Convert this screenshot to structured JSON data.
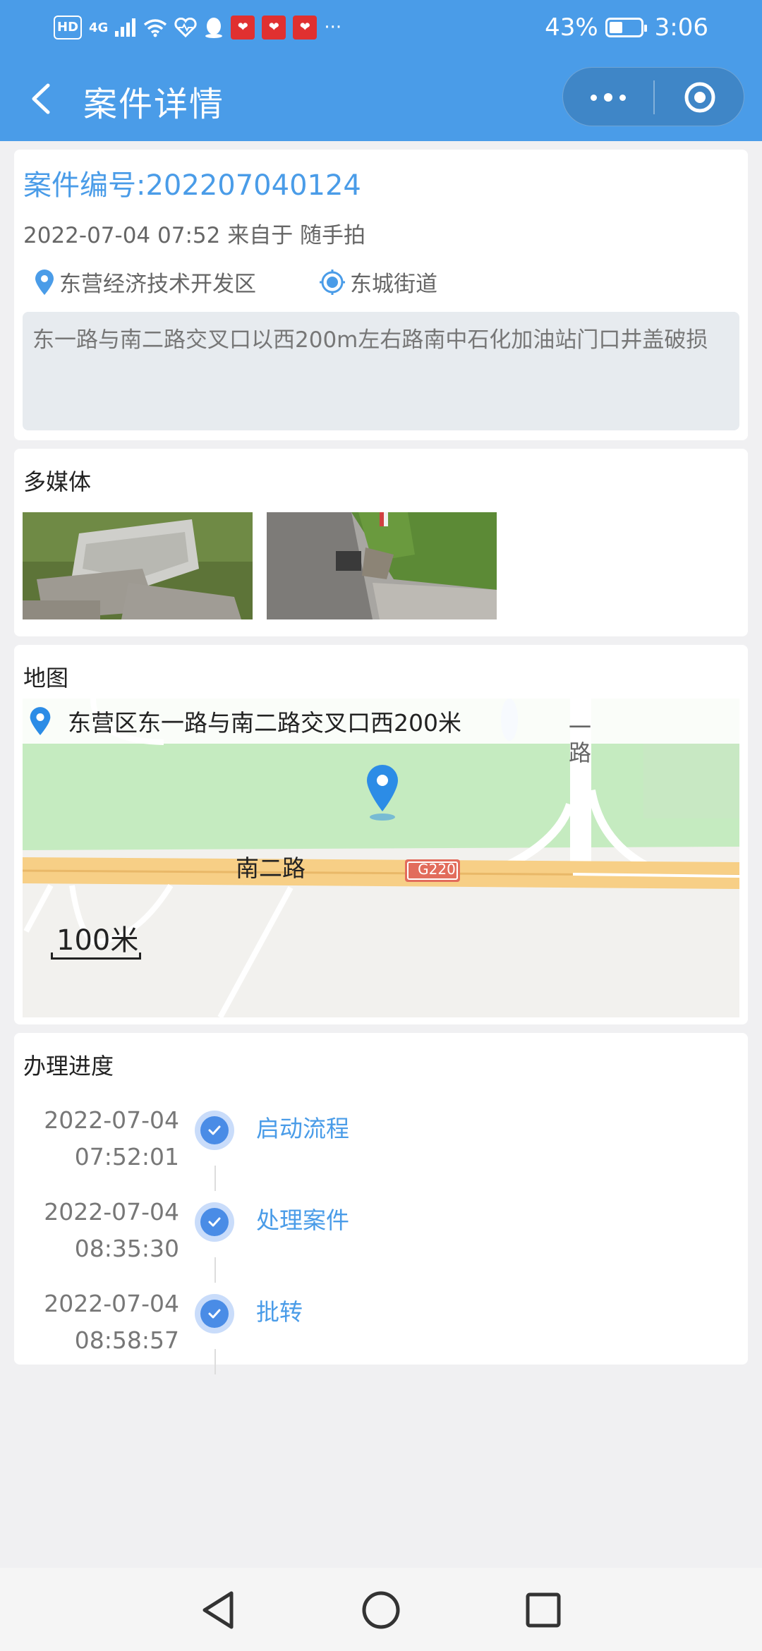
{
  "status_bar": {
    "left_hd": "HD",
    "left_net": "4G",
    "left_more": "···",
    "battery_percent": "43%",
    "battery_level": 0.43,
    "time": "3:06"
  },
  "header": {
    "title": "案件详情",
    "accent_color": "#4a9ce8"
  },
  "case": {
    "number_label": "案件编号:202207040124",
    "meta": "2022-07-04 07:52 来自于 随手拍",
    "district": "东营经济技术开发区",
    "street": "东城街道",
    "description": "东一路与南二路交叉口以西200m左右路南中石化加油站门口井盖破损"
  },
  "media": {
    "title": "多媒体",
    "photos": [
      "photo-broken-manhole-cover",
      "photo-roadside-drain"
    ]
  },
  "map": {
    "title": "地图",
    "address": "东营区东一路与南二路交叉口西200米",
    "road_label": "南二路",
    "road_label_2": "路",
    "road_label_2_top": "一",
    "highway_shield": "G220",
    "scale": "100米"
  },
  "progress": {
    "title": "办理进度",
    "steps": [
      {
        "date": "2022-07-04",
        "time": "07:52:01",
        "label": "启动流程"
      },
      {
        "date": "2022-07-04",
        "time": "08:35:30",
        "label": "处理案件"
      },
      {
        "date": "2022-07-04",
        "time": "08:58:57",
        "label": "批转"
      }
    ]
  }
}
